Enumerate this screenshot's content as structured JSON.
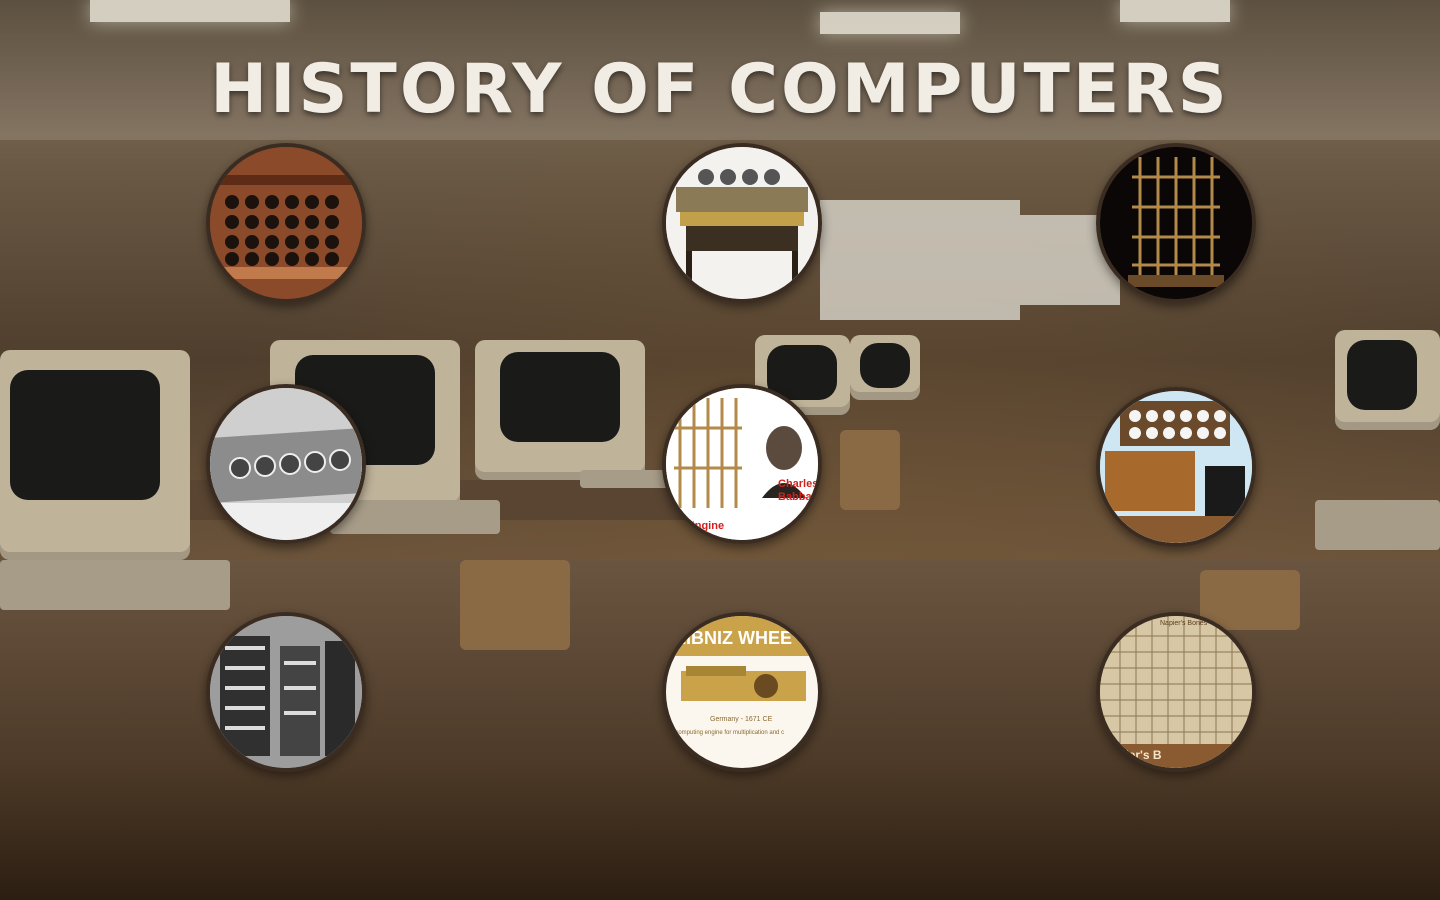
{
  "title": "HISTORY OF COMPUTERS",
  "cards": [
    {
      "name": "abacus",
      "caption": ""
    },
    {
      "name": "difference-engine-photo",
      "caption": ""
    },
    {
      "name": "difference-engine-tower",
      "caption": ""
    },
    {
      "name": "pascaline",
      "caption": ""
    },
    {
      "name": "analytical-engine",
      "caption_top": "Charles Babbag",
      "caption_bottom": "ical Engine"
    },
    {
      "name": "tabulating-machine",
      "caption": ""
    },
    {
      "name": "eniac",
      "caption": ""
    },
    {
      "name": "leibniz-wheel",
      "caption_top": "EIBNIZ WHEE",
      "caption_mid": "Germany - 1671 CE",
      "caption_bottom": "t computing engine for multiplication and c"
    },
    {
      "name": "napiers-bones",
      "caption_top": "Napier's Bones",
      "caption_bottom": "pier's B"
    }
  ],
  "colors": {
    "title": "#f1ede4",
    "circle_border": "#3b2c22",
    "accent_red": "#d0221d"
  }
}
